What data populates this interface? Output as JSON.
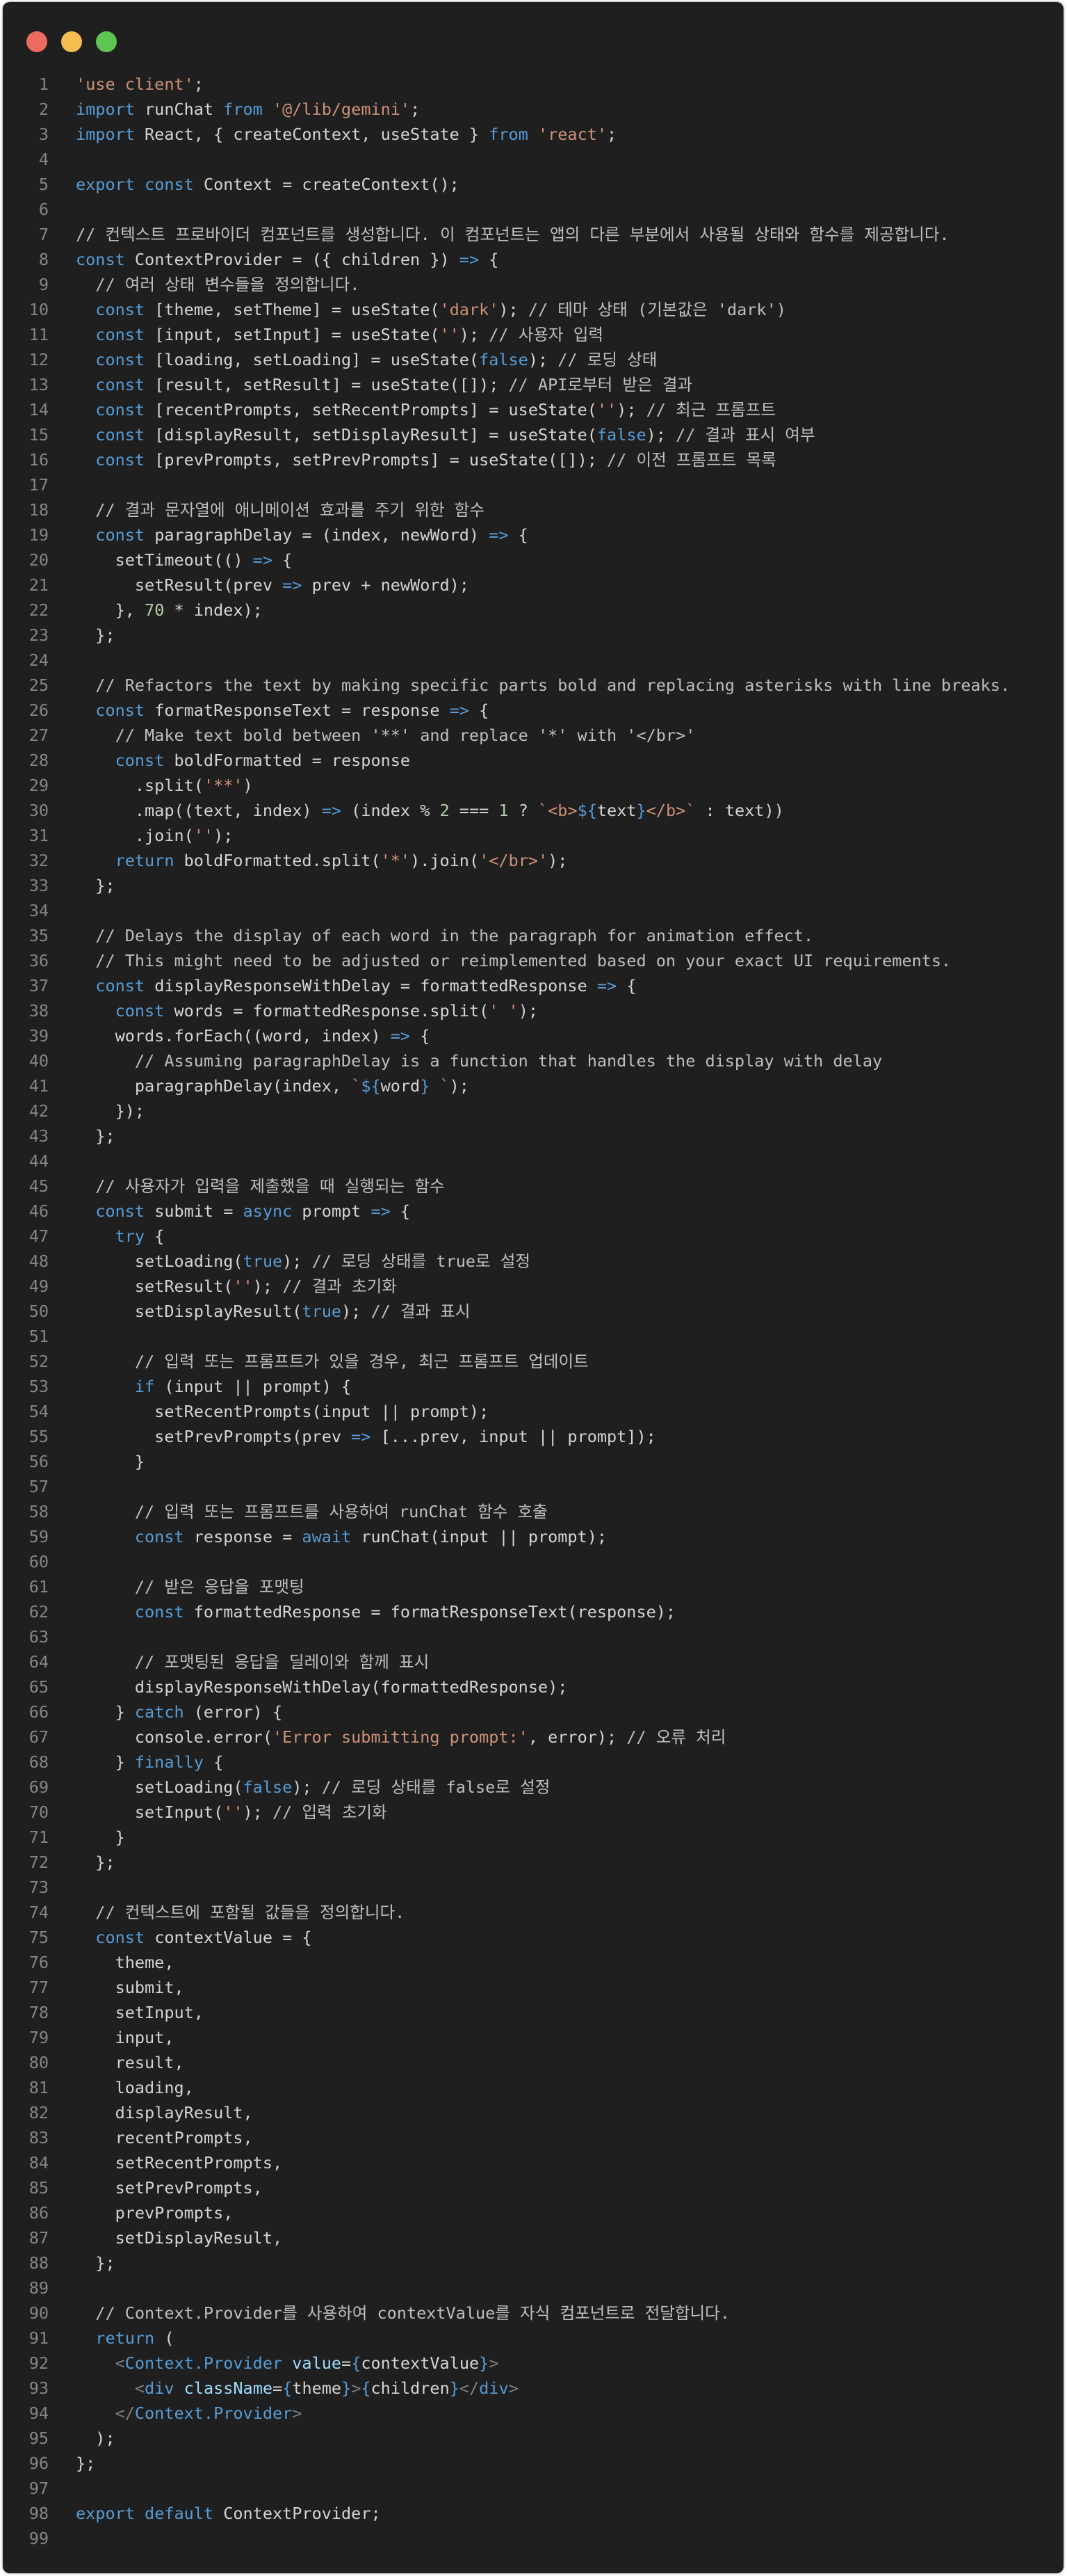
{
  "window": {
    "controls": [
      {
        "name": "close",
        "color": "#ed6a5e"
      },
      {
        "name": "minimize",
        "color": "#f5bf4f"
      },
      {
        "name": "maximize",
        "color": "#61c554"
      }
    ]
  },
  "theme_colors": {
    "background": "#1f1f1f",
    "keyword": "#569cd6",
    "string": "#ce9178",
    "number": "#b5cea8",
    "text": "#d4d4d4",
    "line_number": "#858585",
    "attribute": "#9cdcfe",
    "punctuation": "#808080"
  },
  "code": {
    "language": "javascript",
    "lines": [
      [
        [
          "str",
          "'use client'"
        ],
        [
          "txt",
          ";"
        ]
      ],
      [
        [
          "kw",
          "import"
        ],
        [
          "txt",
          " runChat "
        ],
        [
          "kw",
          "from"
        ],
        [
          "txt",
          " "
        ],
        [
          "str",
          "'@/lib/gemini'"
        ],
        [
          "txt",
          ";"
        ]
      ],
      [
        [
          "kw",
          "import"
        ],
        [
          "txt",
          " React, { createContext, useState } "
        ],
        [
          "kw",
          "from"
        ],
        [
          "txt",
          " "
        ],
        [
          "str",
          "'react'"
        ],
        [
          "txt",
          ";"
        ]
      ],
      [],
      [
        [
          "kw",
          "export"
        ],
        [
          "txt",
          " "
        ],
        [
          "kw",
          "const"
        ],
        [
          "txt",
          " Context = createContext();"
        ]
      ],
      [],
      [
        [
          "com",
          "// 컨텍스트 프로바이더 컴포넌트를 생성합니다. 이 컴포넌트는 앱의 다른 부분에서 사용될 상태와 함수를 제공합니다."
        ]
      ],
      [
        [
          "kw",
          "const"
        ],
        [
          "txt",
          " ContextProvider = ({ children }) "
        ],
        [
          "kw",
          "=>"
        ],
        [
          "txt",
          " {"
        ]
      ],
      [
        [
          "txt",
          "  "
        ],
        [
          "com",
          "// 여러 상태 변수들을 정의합니다."
        ]
      ],
      [
        [
          "txt",
          "  "
        ],
        [
          "kw",
          "const"
        ],
        [
          "txt",
          " [theme, setTheme] = useState("
        ],
        [
          "str",
          "'dark'"
        ],
        [
          "txt",
          "); "
        ],
        [
          "com",
          "// 테마 상태 (기본값은 'dark')"
        ]
      ],
      [
        [
          "txt",
          "  "
        ],
        [
          "kw",
          "const"
        ],
        [
          "txt",
          " [input, setInput] = useState("
        ],
        [
          "str",
          "''"
        ],
        [
          "txt",
          "); "
        ],
        [
          "com",
          "// 사용자 입력"
        ]
      ],
      [
        [
          "txt",
          "  "
        ],
        [
          "kw",
          "const"
        ],
        [
          "txt",
          " [loading, setLoading] = useState("
        ],
        [
          "kw",
          "false"
        ],
        [
          "txt",
          "); "
        ],
        [
          "com",
          "// 로딩 상태"
        ]
      ],
      [
        [
          "txt",
          "  "
        ],
        [
          "kw",
          "const"
        ],
        [
          "txt",
          " [result, setResult] = useState([]); "
        ],
        [
          "com",
          "// API로부터 받은 결과"
        ]
      ],
      [
        [
          "txt",
          "  "
        ],
        [
          "kw",
          "const"
        ],
        [
          "txt",
          " [recentPrompts, setRecentPrompts] = useState("
        ],
        [
          "str",
          "''"
        ],
        [
          "txt",
          "); "
        ],
        [
          "com",
          "// 최근 프롬프트"
        ]
      ],
      [
        [
          "txt",
          "  "
        ],
        [
          "kw",
          "const"
        ],
        [
          "txt",
          " [displayResult, setDisplayResult] = useState("
        ],
        [
          "kw",
          "false"
        ],
        [
          "txt",
          "); "
        ],
        [
          "com",
          "// 결과 표시 여부"
        ]
      ],
      [
        [
          "txt",
          "  "
        ],
        [
          "kw",
          "const"
        ],
        [
          "txt",
          " [prevPrompts, setPrevPrompts] = useState([]); "
        ],
        [
          "com",
          "// 이전 프롬프트 목록"
        ]
      ],
      [],
      [
        [
          "txt",
          "  "
        ],
        [
          "com",
          "// 결과 문자열에 애니메이션 효과를 주기 위한 함수"
        ]
      ],
      [
        [
          "txt",
          "  "
        ],
        [
          "kw",
          "const"
        ],
        [
          "txt",
          " paragraphDelay = (index, newWord) "
        ],
        [
          "kw",
          "=>"
        ],
        [
          "txt",
          " {"
        ]
      ],
      [
        [
          "txt",
          "    setTimeout(() "
        ],
        [
          "kw",
          "=>"
        ],
        [
          "txt",
          " {"
        ]
      ],
      [
        [
          "txt",
          "      setResult(prev "
        ],
        [
          "kw",
          "=>"
        ],
        [
          "txt",
          " prev + newWord);"
        ]
      ],
      [
        [
          "txt",
          "    }, "
        ],
        [
          "num",
          "70"
        ],
        [
          "txt",
          " * index);"
        ]
      ],
      [
        [
          "txt",
          "  };"
        ]
      ],
      [],
      [
        [
          "txt",
          "  "
        ],
        [
          "com",
          "// Refactors the text by making specific parts bold and replacing asterisks with line breaks."
        ]
      ],
      [
        [
          "txt",
          "  "
        ],
        [
          "kw",
          "const"
        ],
        [
          "txt",
          " formatResponseText = response "
        ],
        [
          "kw",
          "=>"
        ],
        [
          "txt",
          " {"
        ]
      ],
      [
        [
          "txt",
          "    "
        ],
        [
          "com",
          "// Make text bold between '**' and replace '*' with '</br>'"
        ]
      ],
      [
        [
          "txt",
          "    "
        ],
        [
          "kw",
          "const"
        ],
        [
          "txt",
          " boldFormatted = response"
        ]
      ],
      [
        [
          "txt",
          "      .split("
        ],
        [
          "str",
          "'**'"
        ],
        [
          "txt",
          ")"
        ]
      ],
      [
        [
          "txt",
          "      .map((text, index) "
        ],
        [
          "kw",
          "=>"
        ],
        [
          "txt",
          " (index % "
        ],
        [
          "num",
          "2"
        ],
        [
          "txt",
          " === "
        ],
        [
          "num",
          "1"
        ],
        [
          "txt",
          " ? "
        ],
        [
          "str",
          "`<b>"
        ],
        [
          "kw",
          "${"
        ],
        [
          "txt",
          "text"
        ],
        [
          "kw",
          "}"
        ],
        [
          "str",
          "</b>`"
        ],
        [
          "txt",
          " : text))"
        ]
      ],
      [
        [
          "txt",
          "      .join("
        ],
        [
          "str",
          "''"
        ],
        [
          "txt",
          ");"
        ]
      ],
      [
        [
          "txt",
          "    "
        ],
        [
          "kw",
          "return"
        ],
        [
          "txt",
          " boldFormatted.split("
        ],
        [
          "str",
          "'*'"
        ],
        [
          "txt",
          ").join("
        ],
        [
          "str",
          "'</br>'"
        ],
        [
          "txt",
          ");"
        ]
      ],
      [
        [
          "txt",
          "  };"
        ]
      ],
      [],
      [
        [
          "txt",
          "  "
        ],
        [
          "com",
          "// Delays the display of each word in the paragraph for animation effect."
        ]
      ],
      [
        [
          "txt",
          "  "
        ],
        [
          "com",
          "// This might need to be adjusted or reimplemented based on your exact UI requirements."
        ]
      ],
      [
        [
          "txt",
          "  "
        ],
        [
          "kw",
          "const"
        ],
        [
          "txt",
          " displayResponseWithDelay = formattedResponse "
        ],
        [
          "kw",
          "=>"
        ],
        [
          "txt",
          " {"
        ]
      ],
      [
        [
          "txt",
          "    "
        ],
        [
          "kw",
          "const"
        ],
        [
          "txt",
          " words = formattedResponse.split("
        ],
        [
          "str",
          "' '"
        ],
        [
          "txt",
          ");"
        ]
      ],
      [
        [
          "txt",
          "    words.forEach((word, index) "
        ],
        [
          "kw",
          "=>"
        ],
        [
          "txt",
          " {"
        ]
      ],
      [
        [
          "txt",
          "      "
        ],
        [
          "com",
          "// Assuming paragraphDelay is a function that handles the display with delay"
        ]
      ],
      [
        [
          "txt",
          "      paragraphDelay(index, "
        ],
        [
          "str",
          "`"
        ],
        [
          "kw",
          "${"
        ],
        [
          "txt",
          "word"
        ],
        [
          "kw",
          "}"
        ],
        [
          "str",
          " `"
        ],
        [
          "txt",
          ");"
        ]
      ],
      [
        [
          "txt",
          "    });"
        ]
      ],
      [
        [
          "txt",
          "  };"
        ]
      ],
      [],
      [
        [
          "txt",
          "  "
        ],
        [
          "com",
          "// 사용자가 입력을 제출했을 때 실행되는 함수"
        ]
      ],
      [
        [
          "txt",
          "  "
        ],
        [
          "kw",
          "const"
        ],
        [
          "txt",
          " submit = "
        ],
        [
          "kw",
          "async"
        ],
        [
          "txt",
          " prompt "
        ],
        [
          "kw",
          "=>"
        ],
        [
          "txt",
          " {"
        ]
      ],
      [
        [
          "txt",
          "    "
        ],
        [
          "kw",
          "try"
        ],
        [
          "txt",
          " {"
        ]
      ],
      [
        [
          "txt",
          "      setLoading("
        ],
        [
          "kw",
          "true"
        ],
        [
          "txt",
          "); "
        ],
        [
          "com",
          "// 로딩 상태를 true로 설정"
        ]
      ],
      [
        [
          "txt",
          "      setResult("
        ],
        [
          "str",
          "''"
        ],
        [
          "txt",
          "); "
        ],
        [
          "com",
          "// 결과 초기화"
        ]
      ],
      [
        [
          "txt",
          "      setDisplayResult("
        ],
        [
          "kw",
          "true"
        ],
        [
          "txt",
          "); "
        ],
        [
          "com",
          "// 결과 표시"
        ]
      ],
      [],
      [
        [
          "txt",
          "      "
        ],
        [
          "com",
          "// 입력 또는 프롬프트가 있을 경우, 최근 프롬프트 업데이트"
        ]
      ],
      [
        [
          "txt",
          "      "
        ],
        [
          "kw",
          "if"
        ],
        [
          "txt",
          " (input || prompt) {"
        ]
      ],
      [
        [
          "txt",
          "        setRecentPrompts(input || prompt);"
        ]
      ],
      [
        [
          "txt",
          "        setPrevPrompts(prev "
        ],
        [
          "kw",
          "=>"
        ],
        [
          "txt",
          " [...prev, input || prompt]);"
        ]
      ],
      [
        [
          "txt",
          "      }"
        ]
      ],
      [],
      [
        [
          "txt",
          "      "
        ],
        [
          "com",
          "// 입력 또는 프롬프트를 사용하여 runChat 함수 호출"
        ]
      ],
      [
        [
          "txt",
          "      "
        ],
        [
          "kw",
          "const"
        ],
        [
          "txt",
          " response = "
        ],
        [
          "kw",
          "await"
        ],
        [
          "txt",
          " runChat(input || prompt);"
        ]
      ],
      [],
      [
        [
          "txt",
          "      "
        ],
        [
          "com",
          "// 받은 응답을 포맷팅"
        ]
      ],
      [
        [
          "txt",
          "      "
        ],
        [
          "kw",
          "const"
        ],
        [
          "txt",
          " formattedResponse = formatResponseText(response);"
        ]
      ],
      [],
      [
        [
          "txt",
          "      "
        ],
        [
          "com",
          "// 포맷팅된 응답을 딜레이와 함께 표시"
        ]
      ],
      [
        [
          "txt",
          "      displayResponseWithDelay(formattedResponse);"
        ]
      ],
      [
        [
          "txt",
          "    } "
        ],
        [
          "kw",
          "catch"
        ],
        [
          "txt",
          " (error) {"
        ]
      ],
      [
        [
          "txt",
          "      console.error("
        ],
        [
          "str",
          "'Error submitting prompt:'"
        ],
        [
          "txt",
          ", error); "
        ],
        [
          "com",
          "// 오류 처리"
        ]
      ],
      [
        [
          "txt",
          "    } "
        ],
        [
          "kw",
          "finally"
        ],
        [
          "txt",
          " {"
        ]
      ],
      [
        [
          "txt",
          "      setLoading("
        ],
        [
          "kw",
          "false"
        ],
        [
          "txt",
          "); "
        ],
        [
          "com",
          "// 로딩 상태를 false로 설정"
        ]
      ],
      [
        [
          "txt",
          "      setInput("
        ],
        [
          "str",
          "''"
        ],
        [
          "txt",
          "); "
        ],
        [
          "com",
          "// 입력 초기화"
        ]
      ],
      [
        [
          "txt",
          "    }"
        ]
      ],
      [
        [
          "txt",
          "  };"
        ]
      ],
      [],
      [
        [
          "txt",
          "  "
        ],
        [
          "com",
          "// 컨텍스트에 포함될 값들을 정의합니다."
        ]
      ],
      [
        [
          "txt",
          "  "
        ],
        [
          "kw",
          "const"
        ],
        [
          "txt",
          " contextValue = {"
        ]
      ],
      [
        [
          "txt",
          "    theme,"
        ]
      ],
      [
        [
          "txt",
          "    submit,"
        ]
      ],
      [
        [
          "txt",
          "    setInput,"
        ]
      ],
      [
        [
          "txt",
          "    input,"
        ]
      ],
      [
        [
          "txt",
          "    result,"
        ]
      ],
      [
        [
          "txt",
          "    loading,"
        ]
      ],
      [
        [
          "txt",
          "    displayResult,"
        ]
      ],
      [
        [
          "txt",
          "    recentPrompts,"
        ]
      ],
      [
        [
          "txt",
          "    setRecentPrompts,"
        ]
      ],
      [
        [
          "txt",
          "    setPrevPrompts,"
        ]
      ],
      [
        [
          "txt",
          "    prevPrompts,"
        ]
      ],
      [
        [
          "txt",
          "    setDisplayResult,"
        ]
      ],
      [
        [
          "txt",
          "  };"
        ]
      ],
      [],
      [
        [
          "txt",
          "  "
        ],
        [
          "com",
          "// Context.Provider를 사용하여 contextValue를 자식 컴포넌트로 전달합니다."
        ]
      ],
      [
        [
          "txt",
          "  "
        ],
        [
          "kw",
          "return"
        ],
        [
          "txt",
          " ("
        ]
      ],
      [
        [
          "txt",
          "    "
        ],
        [
          "punc",
          "<"
        ],
        [
          "tag",
          "Context.Provider"
        ],
        [
          "txt",
          " "
        ],
        [
          "attr",
          "value"
        ],
        [
          "txt",
          "="
        ],
        [
          "kw",
          "{"
        ],
        [
          "txt",
          "contextValue"
        ],
        [
          "kw",
          "}"
        ],
        [
          "punc",
          ">"
        ]
      ],
      [
        [
          "txt",
          "      "
        ],
        [
          "punc",
          "<"
        ],
        [
          "tag",
          "div"
        ],
        [
          "txt",
          " "
        ],
        [
          "attr",
          "className"
        ],
        [
          "txt",
          "="
        ],
        [
          "kw",
          "{"
        ],
        [
          "txt",
          "theme"
        ],
        [
          "kw",
          "}"
        ],
        [
          "punc",
          ">"
        ],
        [
          "kw",
          "{"
        ],
        [
          "txt",
          "children"
        ],
        [
          "kw",
          "}"
        ],
        [
          "punc",
          "</"
        ],
        [
          "tag",
          "div"
        ],
        [
          "punc",
          ">"
        ]
      ],
      [
        [
          "txt",
          "    "
        ],
        [
          "punc",
          "</"
        ],
        [
          "tag",
          "Context.Provider"
        ],
        [
          "punc",
          ">"
        ]
      ],
      [
        [
          "txt",
          "  );"
        ]
      ],
      [
        [
          "txt",
          "};"
        ]
      ],
      [],
      [
        [
          "kw",
          "export"
        ],
        [
          "txt",
          " "
        ],
        [
          "kw",
          "default"
        ],
        [
          "txt",
          " ContextProvider;"
        ]
      ],
      []
    ]
  }
}
